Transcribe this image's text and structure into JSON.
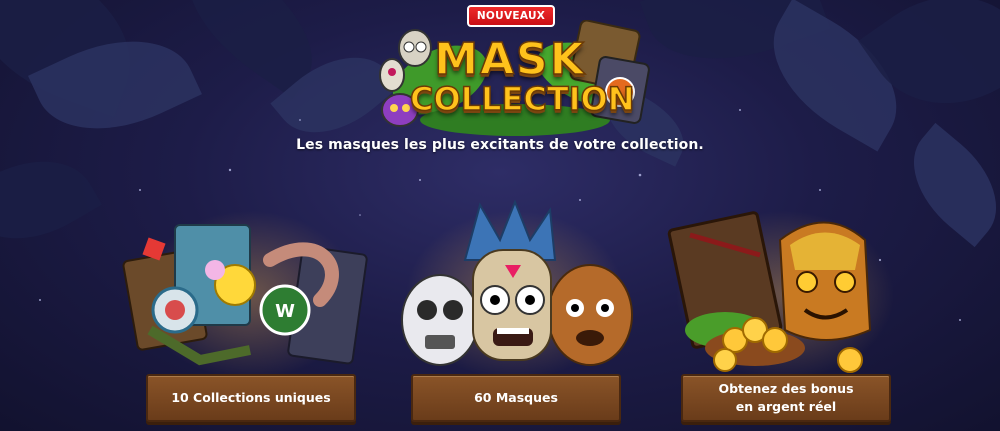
{
  "badge": {
    "label": "NOUVEAUX"
  },
  "logo": {
    "line1": "MASK",
    "line2": "COLLECTION"
  },
  "subtitle": "Les masques les plus excitants de votre collection.",
  "features": [
    {
      "label": "10 Collections uniques"
    },
    {
      "label": "60 Masques"
    },
    {
      "line1": "Obtenez des bonus",
      "line2": "en argent réel"
    }
  ],
  "colors": {
    "background": "#1d1c48",
    "badge": "#e0161c",
    "logo_gold": "#ffc21c",
    "plank": "#7a4820"
  }
}
